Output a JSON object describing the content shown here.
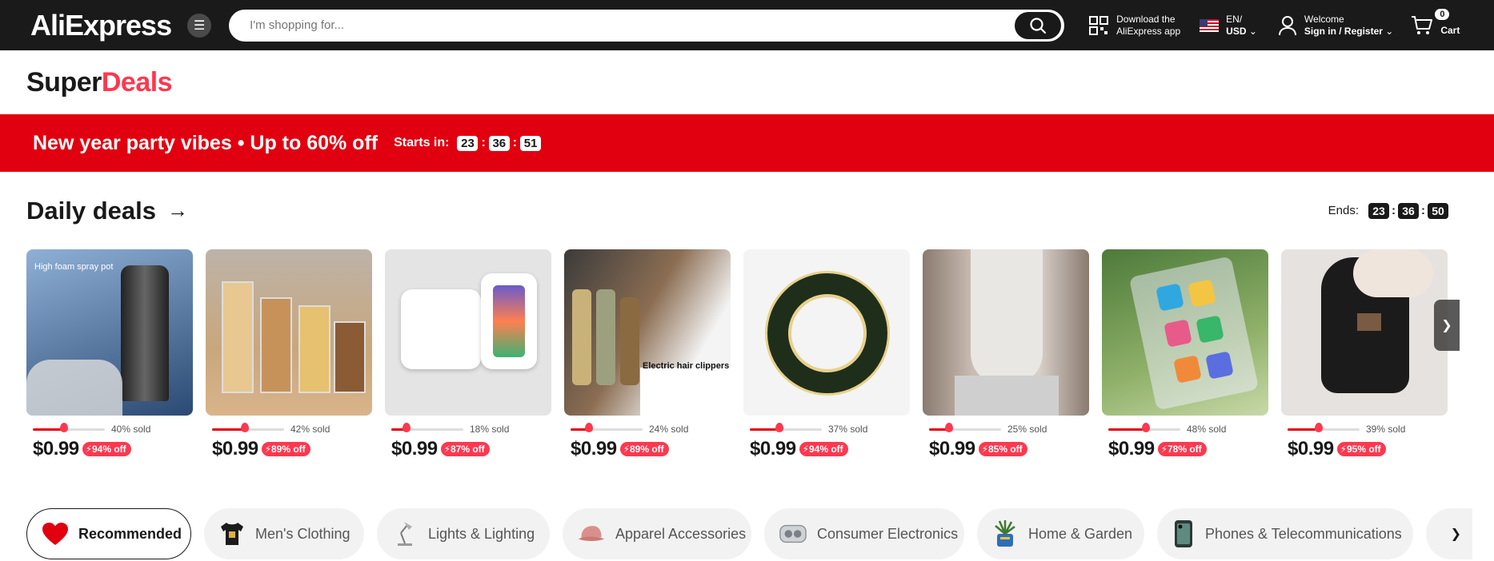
{
  "header": {
    "logo": "AliExpress",
    "search_placeholder": "I'm shopping for...",
    "download_line1": "Download the",
    "download_line2": "AliExpress app",
    "lang_line1": "EN/",
    "lang_line2": "USD",
    "welcome_line1": "Welcome",
    "welcome_line2": "Sign in / Register",
    "cart_count": "0",
    "cart_label": "Cart"
  },
  "superdeals": {
    "part1": "Super",
    "part2": "Deals"
  },
  "banner": {
    "title": "New year party vibes • Up to 60% off",
    "starts_label": "Starts in:",
    "hh": "23",
    "mm": "36",
    "ss": "51"
  },
  "daily": {
    "title": "Daily deals",
    "ends_label": "Ends:",
    "hh": "23",
    "mm": "36",
    "ss": "50"
  },
  "products": [
    {
      "sold": "40% sold",
      "sold_pct": 0.4,
      "price": "$0.99",
      "off": "94% off",
      "img_text": "High foam spray pot",
      "color": "#5b7ea8"
    },
    {
      "sold": "42% sold",
      "sold_pct": 0.42,
      "price": "$0.99",
      "off": "89% off",
      "img_text": "",
      "color": "#c9a77d"
    },
    {
      "sold": "18% sold",
      "sold_pct": 0.18,
      "price": "$0.99",
      "off": "87% off",
      "img_text": "",
      "color": "#dcdcdc"
    },
    {
      "sold": "24% sold",
      "sold_pct": 0.24,
      "price": "$0.99",
      "off": "89% off",
      "img_text": "Electric hair clippers",
      "color": "#b5895a"
    },
    {
      "sold": "37% sold",
      "sold_pct": 0.37,
      "price": "$0.99",
      "off": "94% off",
      "img_text": "",
      "color": "#f2f2f2"
    },
    {
      "sold": "25% sold",
      "sold_pct": 0.25,
      "price": "$0.99",
      "off": "85% off",
      "img_text": "",
      "color": "#b9aca3"
    },
    {
      "sold": "48% sold",
      "sold_pct": 0.48,
      "price": "$0.99",
      "off": "78% off",
      "img_text": "",
      "color": "#6f8f4e"
    },
    {
      "sold": "39% sold",
      "sold_pct": 0.39,
      "price": "$0.99",
      "off": "95% off",
      "img_text": "",
      "color": "#d8d3cf"
    }
  ],
  "categories": [
    {
      "label": "Recommended",
      "active": true
    },
    {
      "label": "Men's Clothing",
      "active": false
    },
    {
      "label": "Lights & Lighting",
      "active": false
    },
    {
      "label": "Apparel Accessories",
      "active": false
    },
    {
      "label": "Consumer Electronics",
      "active": false
    },
    {
      "label": "Home & Garden",
      "active": false
    },
    {
      "label": "Phones & Telecommunications",
      "active": false
    }
  ],
  "colors": {
    "brand_red": "#e1000f",
    "deal_red": "#fd384f",
    "header_bg": "#1a1a1a"
  }
}
